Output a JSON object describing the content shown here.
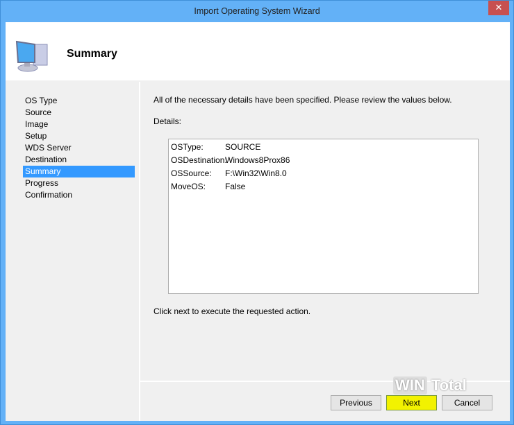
{
  "window": {
    "title": "Import Operating System Wizard",
    "close": "✕"
  },
  "header": {
    "title": "Summary"
  },
  "nav": {
    "items": [
      "OS Type",
      "Source",
      "Image",
      "Setup",
      "WDS Server",
      "Destination",
      "Summary",
      "Progress",
      "Confirmation"
    ],
    "selected": 6
  },
  "main": {
    "intro": "All of the necessary details have been specified.  Please review the values below.",
    "details_label": "Details:",
    "details": [
      {
        "key": "OSType:",
        "value": "SOURCE"
      },
      {
        "key": "OSDestination:",
        "value": "Windows8Prox86"
      },
      {
        "key": "OSSource:",
        "value": "F:\\Win32\\Win8.0"
      },
      {
        "key": "MoveOS:",
        "value": "False"
      }
    ],
    "footer": "Click next to execute the requested action."
  },
  "buttons": {
    "previous": "Previous",
    "next": "Next",
    "cancel": "Cancel"
  },
  "watermark": {
    "a": "WIN",
    "b": "Total"
  },
  "colors": {
    "accent": "#3399ff",
    "titlebar": "#63b1f7",
    "next": "#f2f200",
    "close": "#c75050"
  }
}
